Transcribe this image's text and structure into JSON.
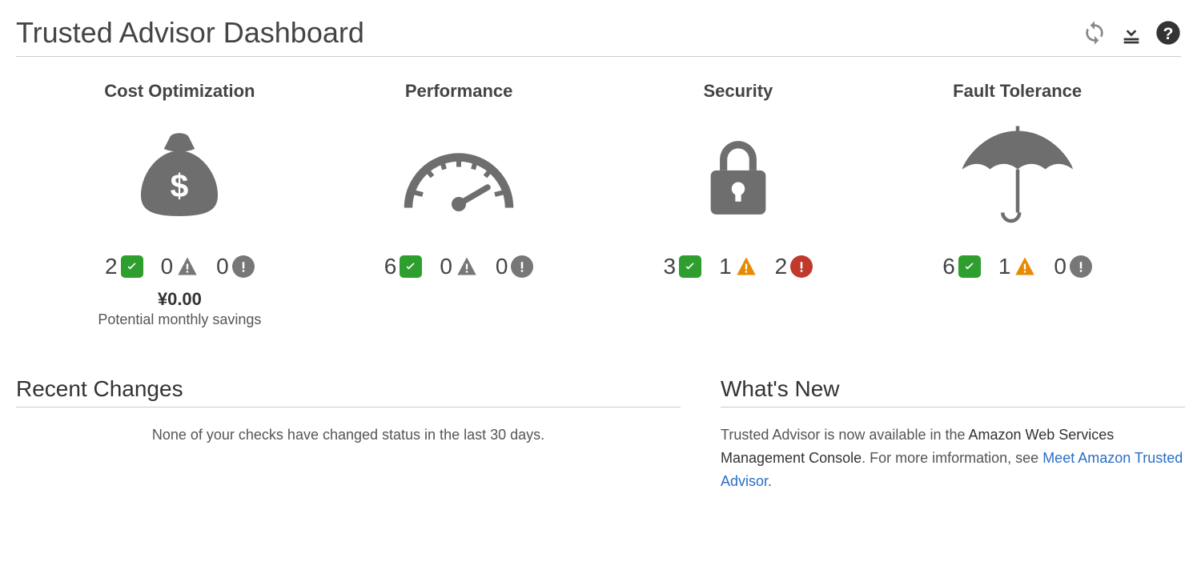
{
  "header": {
    "title": "Trusted Advisor Dashboard"
  },
  "categories": [
    {
      "id": "cost",
      "title": "Cost Optimization",
      "ok": 2,
      "warn": 0,
      "err": 0,
      "err_style": "mute",
      "savings_amount": "¥0.00",
      "savings_label": "Potential monthly savings"
    },
    {
      "id": "perf",
      "title": "Performance",
      "ok": 6,
      "warn": 0,
      "err": 0,
      "err_style": "mute"
    },
    {
      "id": "sec",
      "title": "Security",
      "ok": 3,
      "warn": 1,
      "err": 2,
      "err_style": "err"
    },
    {
      "id": "fault",
      "title": "Fault Tolerance",
      "ok": 6,
      "warn": 1,
      "err": 0,
      "err_style": "mute"
    }
  ],
  "recent_changes": {
    "title": "Recent Changes",
    "body": "None of your checks have changed status in the last 30 days."
  },
  "whats_new": {
    "title": "What's New",
    "text_a": "Trusted Advisor is now available in the ",
    "text_b": "Amazon Web Services Management Console",
    "text_c": ". For more imformation, see ",
    "link": "Meet Amazon Trusted Advisor",
    "text_d": "."
  }
}
